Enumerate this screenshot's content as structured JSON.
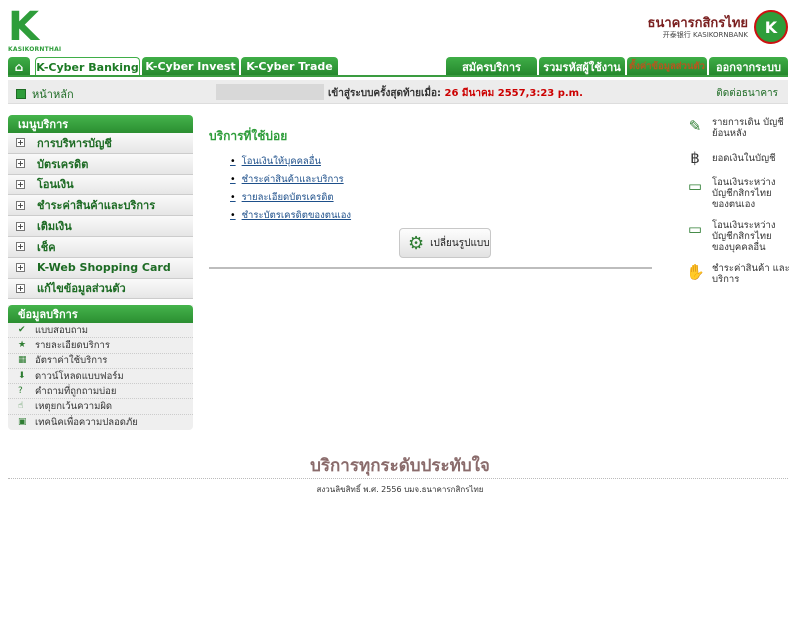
{
  "header": {
    "logo_left_text": "KASIKORNTHAI",
    "logo_right_thai": "ธนาคารกสิกรไทย",
    "logo_right_eng": "开泰银行 KASIKORNBANK"
  },
  "nav": {
    "tabs": [
      {
        "label": "K-Cyber Banking"
      },
      {
        "label": "K-Cyber Invest"
      },
      {
        "label": "K-Cyber Trade"
      }
    ],
    "right_tabs": [
      {
        "label": "สมัครบริการ"
      },
      {
        "label": "รวมรหัสผู้ใช้งาน"
      },
      {
        "label": "ตั้งค่าข้อมูลส่วนตัว"
      },
      {
        "label": "ออกจากระบบ"
      }
    ]
  },
  "subbar": {
    "home": "หน้าหลัก",
    "last_login_label": "เข้าสู่ระบบครั้งสุดท้ายเมื่อ:",
    "last_login_value": "26 มีนาคม 2557,3:23 p.m.",
    "contact": "ติดต่อธนาคาร"
  },
  "sidebar": {
    "title": "เมนูบริการ",
    "items": [
      {
        "label": "การบริหารบัญชี"
      },
      {
        "label": "บัตรเครดิต"
      },
      {
        "label": "โอนเงิน"
      },
      {
        "label": "ชำระค่าสินค้าและบริการ"
      },
      {
        "label": "เติมเงิน"
      },
      {
        "label": "เช็ค"
      },
      {
        "label": "K-Web Shopping Card"
      },
      {
        "label": "แก้ไขข้อมูลส่วนตัว"
      }
    ]
  },
  "info": {
    "title": "ข้อมูลบริการ",
    "items": [
      {
        "label": "แบบสอบถาม"
      },
      {
        "label": "รายละเอียดบริการ"
      },
      {
        "label": "อัตราค่าใช้บริการ"
      },
      {
        "label": "ดาวน์โหลดแบบฟอร์ม"
      },
      {
        "label": "คำถามที่ถูกถามบ่อย"
      },
      {
        "label": "เหตุยกเว้นความผิด"
      },
      {
        "label": "เทคนิคเพื่อความปลอดภัย"
      }
    ]
  },
  "main": {
    "title": "บริการที่ใช้บ่อย",
    "links": [
      {
        "label": "โอนเงินให้บุคคลอื่น"
      },
      {
        "label": "ชำระค่าสินค้าและบริการ"
      },
      {
        "label": "รายละเอียดบัตรเครดิต"
      },
      {
        "label": "ชำระบัตรเครดิตของตนเอง"
      }
    ],
    "change_button": "เปลี่ยนรูปแบบ"
  },
  "quick": [
    {
      "label": "รายการเดิน บัญชีย้อนหลัง"
    },
    {
      "label": "ยอดเงินในบัญชี"
    },
    {
      "label": "โอนเงินระหว่าง บัญชีกสิกรไทย ของตนเอง"
    },
    {
      "label": "โอนเงินระหว่าง บัญชีกสิกรไทย ของบุคคลอื่น"
    },
    {
      "label": "ชำระค่าสินค้า และบริการ"
    }
  ],
  "footer": {
    "slogan": "บริการทุกระดับประทับใจ",
    "copyright": "สงวนลิขสิทธิ์ พ.ศ. 2556 บมจ.ธนาคารกสิกรไทย"
  }
}
